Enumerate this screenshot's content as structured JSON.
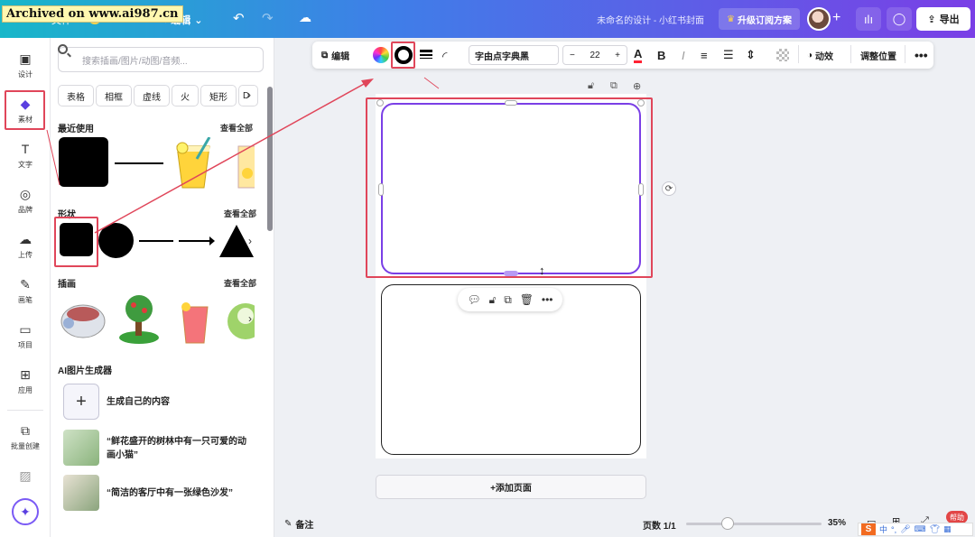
{
  "watermark": "Archived on www.ai987.cn",
  "topbar": {
    "file_label": "文件",
    "edit_label": "编辑",
    "doc_title": "未命名的设计 - 小红书封面",
    "upgrade_label": "升级订阅方案",
    "export_label": "导出"
  },
  "leftnav": {
    "items": [
      {
        "label": "设计"
      },
      {
        "label": "素材"
      },
      {
        "label": "文字"
      },
      {
        "label": "品牌"
      },
      {
        "label": "上传"
      },
      {
        "label": "画笔"
      },
      {
        "label": "项目"
      },
      {
        "label": "应用"
      },
      {
        "label": "批量创建"
      }
    ]
  },
  "panel": {
    "search_placeholder": "搜索插画/图片/动图/音频...",
    "chips": [
      "表格",
      "相框",
      "虚线",
      "火",
      "矩形"
    ],
    "recent_title": "最近使用",
    "shapes_title": "形状",
    "illustrations_title": "插画",
    "see_all": "查看全部",
    "ai_title": "AI图片生成器",
    "ai_create": "生成自己的内容",
    "ai_example1": "“鲜花盛开的树林中有一只可爱的动画小猫”",
    "ai_example2": "“简洁的客厅中有一张绿色沙发”"
  },
  "toolbar": {
    "edit_label": "编辑",
    "font": "字由点字典黑",
    "font_size": "22",
    "animate_label": "动效",
    "position_label": "调整位置"
  },
  "canvas": {
    "add_page": "+添加页面"
  },
  "bottombar": {
    "notes_label": "备注",
    "pages_label": "页数 1/1",
    "zoom_label": "35%",
    "help_label": "帮助"
  },
  "ime": {
    "lang": "中"
  },
  "colors": {
    "accent": "#7a3fe6",
    "highlight": "#e0465a",
    "gradient_start": "#18b7c9",
    "gradient_end": "#7a3fe6"
  }
}
